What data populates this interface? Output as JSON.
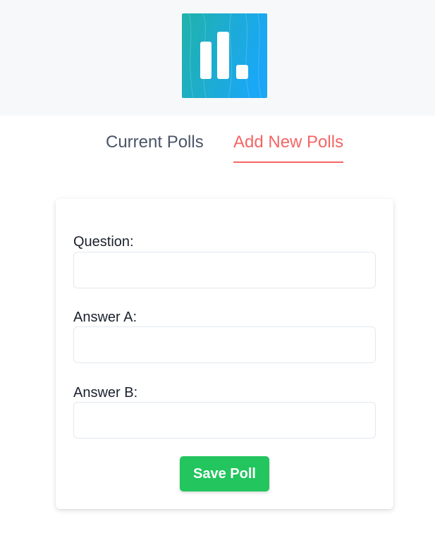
{
  "header": {
    "logo_icon": "bar-chart-logo-icon",
    "logo_colors": {
      "gradient_start": "#20b2aa",
      "gradient_end": "#1aa7f5",
      "bars": "#ffffff"
    }
  },
  "tabs": {
    "current": "Current Polls",
    "add_new": "Add New Polls",
    "active": "Add New Polls",
    "active_color": "#f56565",
    "inactive_color": "#4a5568"
  },
  "form": {
    "question_label": "Question:",
    "question_value": "",
    "answer_a_label": "Answer A:",
    "answer_a_value": "",
    "answer_b_label": "Answer B:",
    "answer_b_value": "",
    "save_label": "Save Poll",
    "save_color": "#22c55e"
  }
}
